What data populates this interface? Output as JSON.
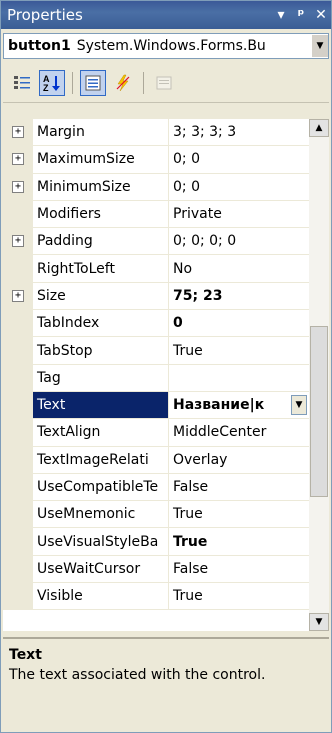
{
  "titlebar": {
    "title": "Properties",
    "pin_icon": "▼",
    "pin2_icon": "ᵖ",
    "close_icon": "✕"
  },
  "object_selector": {
    "name": "button1",
    "type": "System.Windows.Forms.Bu",
    "drop_icon": "▼"
  },
  "toolbar": {
    "categorized_icon": "categorized-icon",
    "alphabetical_icon": "alphabetical-icon",
    "properties_icon": "properties-icon",
    "events_icon": "events-icon",
    "pages_icon": "property-pages-icon"
  },
  "properties": [
    {
      "name": "Margin",
      "value": "3; 3; 3; 3",
      "expandable": true
    },
    {
      "name": "MaximumSize",
      "value": "0; 0",
      "expandable": true
    },
    {
      "name": "MinimumSize",
      "value": "0; 0",
      "expandable": true
    },
    {
      "name": "Modifiers",
      "value": "Private",
      "expandable": false
    },
    {
      "name": "Padding",
      "value": "0; 0; 0; 0",
      "expandable": true
    },
    {
      "name": "RightToLeft",
      "value": "No",
      "expandable": false
    },
    {
      "name": "Size",
      "value": "75; 23",
      "expandable": true,
      "bold": true
    },
    {
      "name": "TabIndex",
      "value": "0",
      "expandable": false,
      "bold": true
    },
    {
      "name": "TabStop",
      "value": "True",
      "expandable": false
    },
    {
      "name": "Tag",
      "value": "",
      "expandable": false
    },
    {
      "name": "Text",
      "value": "Название|к",
      "expandable": false,
      "selected": true
    },
    {
      "name": "TextAlign",
      "value": "MiddleCenter",
      "expandable": false
    },
    {
      "name": "TextImageRelati",
      "value": "Overlay",
      "expandable": false
    },
    {
      "name": "UseCompatibleTe",
      "value": "False",
      "expandable": false
    },
    {
      "name": "UseMnemonic",
      "value": "True",
      "expandable": false
    },
    {
      "name": "UseVisualStyleBa",
      "value": "True",
      "expandable": false,
      "bold": true
    },
    {
      "name": "UseWaitCursor",
      "value": "False",
      "expandable": false
    },
    {
      "name": "Visible",
      "value": "True",
      "expandable": false
    }
  ],
  "description": {
    "title": "Text",
    "text": "The text associated with the control."
  },
  "colors": {
    "selection": "#0A246A",
    "title_bar": "#3B5998",
    "chrome": "#ECE9D8"
  },
  "scroll": {
    "position_fraction": 0.62
  }
}
